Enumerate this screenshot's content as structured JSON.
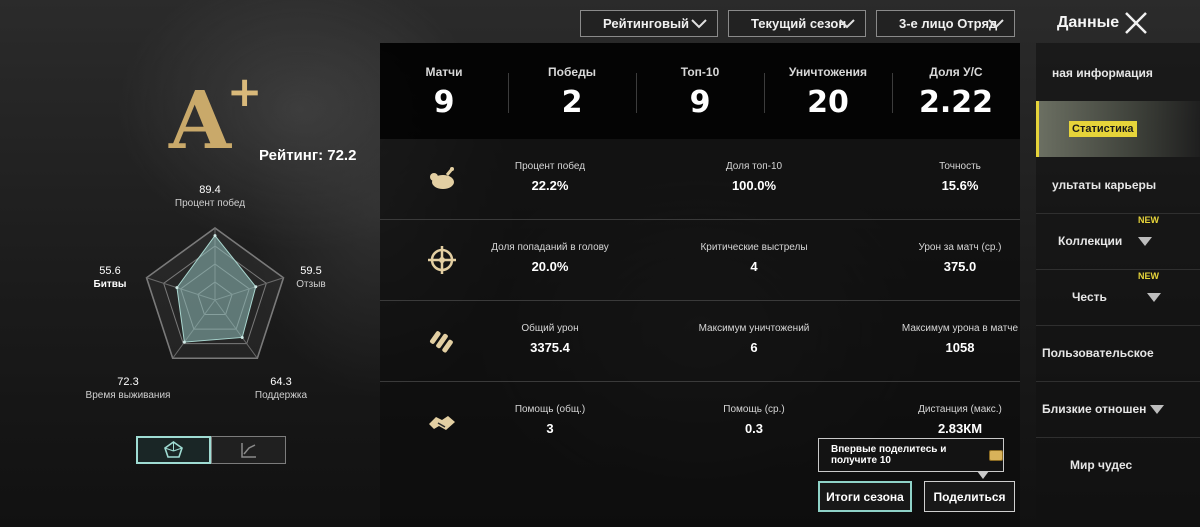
{
  "filters": {
    "mode": "Рейтинговый",
    "season": "Текущий сезон",
    "squad": "3-е лицо Отряд"
  },
  "header": {
    "title": "Данные"
  },
  "grade": {
    "letter": "A",
    "plus": "+",
    "rating_label": "Рейтинг: 72.2"
  },
  "radar": {
    "axes": [
      {
        "value": "89.4",
        "label": "Процент побед"
      },
      {
        "value": "59.5",
        "label": "Отзыв"
      },
      {
        "value": "64.3",
        "label": "Поддержка"
      },
      {
        "value": "72.3",
        "label": "Время выживания"
      },
      {
        "value": "55.6",
        "label": "Битвы"
      }
    ],
    "levels": [
      0.894,
      0.595,
      0.643,
      0.723,
      0.556
    ]
  },
  "summary": [
    {
      "label": "Матчи",
      "value": "9"
    },
    {
      "label": "Победы",
      "value": "2"
    },
    {
      "label": "Топ-10",
      "value": "9"
    },
    {
      "label": "Уничтожения",
      "value": "20"
    },
    {
      "label": "Доля У/С",
      "value": "2.22"
    }
  ],
  "rows": [
    {
      "icon": "chicken-icon",
      "stats": [
        {
          "label": "Процент побед",
          "value": "22.2%"
        },
        {
          "label": "Доля топ-10",
          "value": "100.0%"
        },
        {
          "label": "Точность",
          "value": "15.6%"
        }
      ]
    },
    {
      "icon": "crosshair-icon",
      "stats": [
        {
          "label": "Доля попаданий в голову",
          "value": "20.0%"
        },
        {
          "label": "Критические выстрелы",
          "value": "4"
        },
        {
          "label": "Урон за матч (ср.)",
          "value": "375.0"
        }
      ]
    },
    {
      "icon": "bullets-icon",
      "stats": [
        {
          "label": "Общий урон",
          "value": "3375.4"
        },
        {
          "label": "Максимум уничтожений",
          "value": "6"
        },
        {
          "label": "Максимум урона в матче",
          "value": "1058"
        }
      ]
    },
    {
      "icon": "handshake-icon",
      "stats": [
        {
          "label": "Помощь (общ.)",
          "value": "3"
        },
        {
          "label": "Помощь (ср.)",
          "value": "0.3"
        },
        {
          "label": "Дистанция (макс.)",
          "value": "2.83КМ"
        }
      ]
    }
  ],
  "tooltip": {
    "text": "Впервые поделитесь и получите 10"
  },
  "buttons": {
    "season_summary": "Итоги сезона",
    "share": "Поделиться"
  },
  "sidebar": {
    "items": [
      {
        "label": "ная информация"
      },
      {
        "label": "Статистика"
      },
      {
        "label": "ультаты карьеры"
      },
      {
        "label": "Коллекции",
        "badge": "NEW"
      },
      {
        "label": "Честь",
        "badge": "NEW"
      },
      {
        "label": "Пользовательское"
      },
      {
        "label": "Близкие отношен"
      },
      {
        "label": "Мир чудес"
      }
    ]
  },
  "colors": {
    "accent_teal": "#8fd2c8",
    "accent_yellow": "#e6d43a",
    "grade_gold": "#c9a96a"
  }
}
